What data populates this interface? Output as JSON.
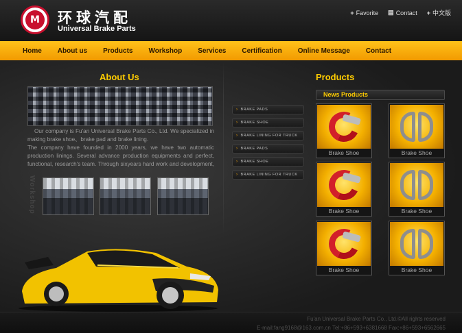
{
  "header": {
    "logo_mark": "M",
    "title_cn": "环球汽配",
    "title_en": "Universal Brake Parts",
    "links": [
      {
        "icon": "plus-icon",
        "label": "Favorite",
        "glyph": "+"
      },
      {
        "icon": "document-icon",
        "label": "Contact",
        "glyph": "▤"
      },
      {
        "icon": "plus-icon",
        "label": "中文版",
        "glyph": "+"
      }
    ]
  },
  "nav": {
    "items": [
      "Home",
      "About us",
      "Products",
      "Workshop",
      "Services",
      "Certification",
      "Online Message",
      "Contact"
    ]
  },
  "about": {
    "heading": "About Us",
    "text_1": "Our company is Fu'an Universal Brake Parts Co., Ltd. We specialized in making brake shoe、brake pad and brake lining.",
    "text_2": "The company have founded in 2000 years, we have two automatic production linings. Several advance production equipments and perfect, functional, research's team. Through sixyears hard work and development, we",
    "workshop_label": "Workshop"
  },
  "side_list": {
    "items": [
      "BRAKE PADS",
      "BRAKE SHOE",
      "BRAKE LINING FOR TRUCK",
      "BRAKE PADS",
      "BRAKE SHOE",
      "BRAKE LINING FOR TRUCK"
    ]
  },
  "products": {
    "heading": "Products",
    "news_label": "News Products",
    "items": [
      {
        "label": "Brake Shoe",
        "kind": "red"
      },
      {
        "label": "Brake Shoe",
        "kind": "steel"
      },
      {
        "label": "Brake Shoe",
        "kind": "red"
      },
      {
        "label": "Brake Shoe",
        "kind": "steel"
      },
      {
        "label": "Brake Shoe",
        "kind": "red"
      },
      {
        "label": "Brake Shoe",
        "kind": "steel"
      }
    ]
  },
  "footer": {
    "line1": "Fu'an Universal Brake Parts Co., Ltd.©All rights reserved",
    "line2": "E-mail:fang9168@163.com.cn Tel:+86+593+6381668  Fax:+86+593+6562665"
  }
}
